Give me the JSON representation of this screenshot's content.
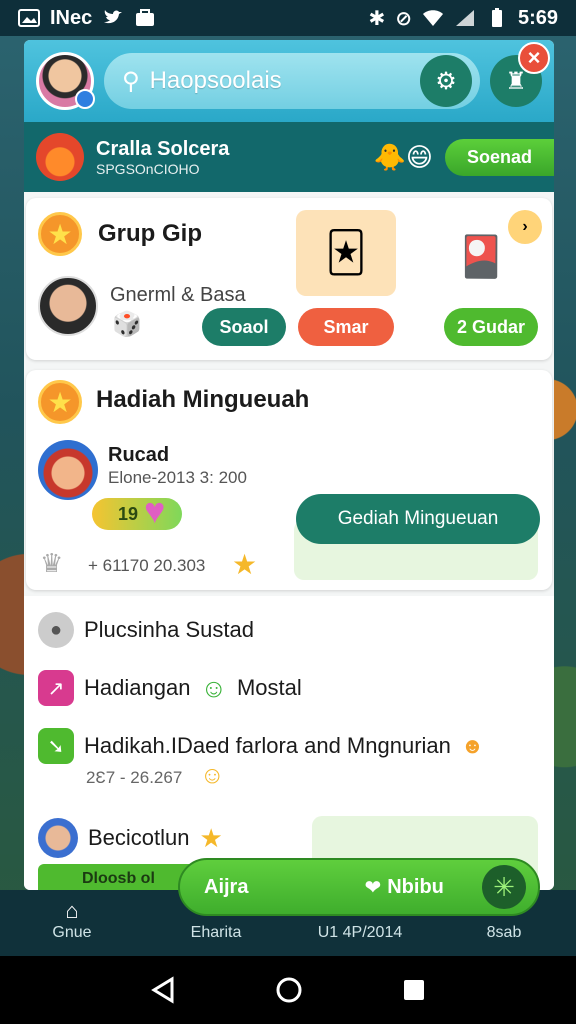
{
  "status_bar": {
    "app_label": "INec",
    "time": "5:69"
  },
  "header": {
    "search_placeholder": "Haopsoolais"
  },
  "banner": {
    "title": "Cralla Solcera",
    "subtitle": "SPGSOnCIOHO",
    "button": "Soenad"
  },
  "group_card": {
    "title": "Grup Gip",
    "member_text": "Gnerml & Basa",
    "btn_soaol": "Soaol",
    "btn_smar": "Smar",
    "btn_gudar": "2 Gudar"
  },
  "weekly_card": {
    "title": "Hadiah Mingueuah",
    "player_name": "Rucad",
    "player_sub": "Elone-2013 3: 200",
    "level": "19",
    "cta": "Gediah Mingueuan",
    "stats": "+ 61170 20.303"
  },
  "list": {
    "item1": "Plucsinha Sustad",
    "item2_a": "Hadiangan",
    "item2_b": "Mostal",
    "item3": "Hadikah.IDaed farlora and Mngnurian",
    "item3_sub": "2Ɛ7 - 26.267",
    "item4": "Becicotlun",
    "item5": "Dloosb ol"
  },
  "floating_bar": {
    "left": "Aijra",
    "mid": "Nbibu"
  },
  "bottom_nav": {
    "tab1": "Gnue",
    "tab2": "Eharita",
    "tab3": "U1  4P/2014",
    "tab4": "8sab"
  }
}
